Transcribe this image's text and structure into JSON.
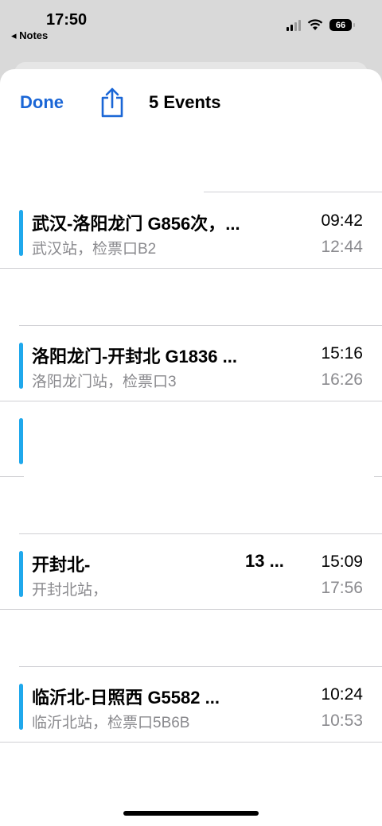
{
  "status_bar": {
    "time": "17:50",
    "back_label": "◂ Notes",
    "battery": "66"
  },
  "nav": {
    "done_label": "Done",
    "title": "5 Events"
  },
  "events": [
    {
      "title": "武汉-洛阳龙门 G856次，...",
      "subtitle": "武汉站，检票口B2",
      "start": "09:42",
      "end": "12:44"
    },
    {
      "title": "洛阳龙门-开封北 G1836 ...",
      "subtitle": "洛阳龙门站，检票口3",
      "start": "15:16",
      "end": "16:26"
    },
    {
      "title": "",
      "subtitle": "",
      "start": "",
      "end": ""
    },
    {
      "title": "开封北-",
      "title_tail": "13 ...",
      "subtitle": "开封北站，",
      "start": "15:09",
      "end": "17:56"
    },
    {
      "title": "临沂北-日照西 G5582 ...",
      "subtitle": "临沂北站，检票口5B6B",
      "start": "10:24",
      "end": "10:53"
    }
  ]
}
